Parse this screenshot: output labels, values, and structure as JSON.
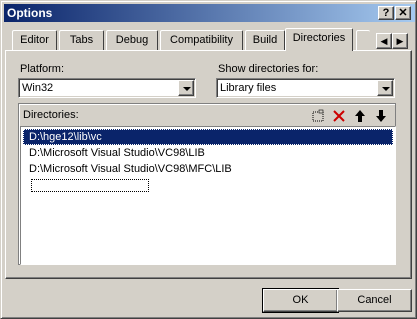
{
  "window": {
    "title": "Options",
    "help_btn": "?",
    "close_btn": "✕"
  },
  "tabs": [
    {
      "label": "Editor"
    },
    {
      "label": "Tabs"
    },
    {
      "label": "Debug"
    },
    {
      "label": "Compatibility"
    },
    {
      "label": "Build"
    },
    {
      "label": "Directories"
    }
  ],
  "tab_scroll": {
    "left": "◀",
    "right": "▶"
  },
  "platform": {
    "label": "Platform:",
    "value": "Win32"
  },
  "show_dirs": {
    "label": "Show directories for:",
    "value": "Library files"
  },
  "directories": {
    "label": "Directories:",
    "items": [
      "D:\\hge12\\lib\\vc",
      "D:\\Microsoft Visual Studio\\VC98\\LIB",
      "D:\\Microsoft Visual Studio\\VC98\\MFC\\LIB"
    ],
    "selected_index": 0
  },
  "toolbar": {
    "new_icon": "new-folder-icon",
    "delete_icon": "delete-icon",
    "up_icon": "move-up-icon",
    "down_icon": "move-down-icon",
    "delete_color": "#cc0000"
  },
  "buttons": {
    "ok": "OK",
    "cancel": "Cancel"
  }
}
